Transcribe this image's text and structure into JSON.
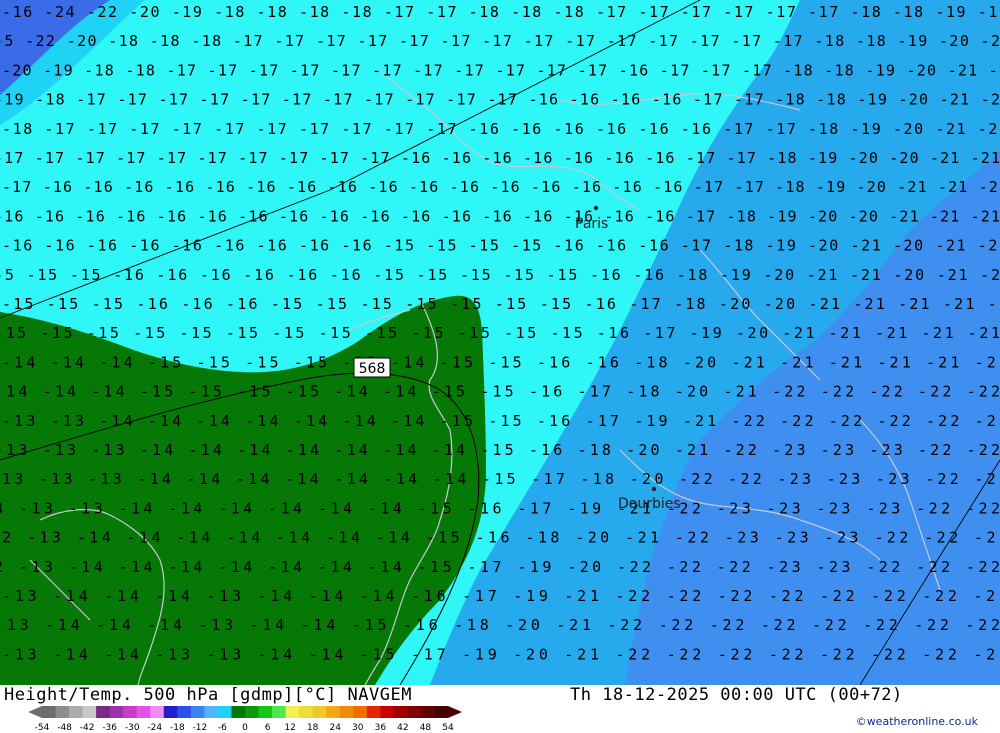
{
  "map": {
    "colors": {
      "deep_blue": "#3a6be8",
      "blue": "#3f8ff0",
      "light_blue": "#27a9ee",
      "sky": "#1fd3f7",
      "cyan": "#2ff7f7",
      "green": "#067806",
      "contour": "#000000",
      "coast": "#c8c8d8"
    },
    "height_contour_label": "568",
    "cities": [
      {
        "name": "Paris"
      },
      {
        "name": "Dourbies"
      }
    ],
    "temperature_grid": [
      "-16 -24 -22 -20 -19 -18 -18 -18 -18 -17 -17 -18 -18 -18 -17 -17 -17 -17 -17 -17 -18 -18 -19 -19",
      "-5 -22 -20 -18 -18 -18 -17 -17 -17 -17 -17 -17 -17 -17 -17 -17 -17 -17 -17 -17 -18 -18 -19 -20 -2",
      "-20 -19 -18 -18 -17 -17 -17 -17 -17 -17 -17 -17 -17 -17 -17 -16 -17 -17 -17 -18 -18 -19 -20 -21 -2",
      "-19 -18 -17 -17 -17 -17 -17 -17 -17 -17 -17 -17 -17 -16 -16 -16 -16 -17 -17 -18 -18 -19 -20 -21 -2",
      "-18 -17 -17 -17 -17 -17 -17 -17 -17 -17 -17 -16 -16 -16 -16 -16 -16 -17 -17 -18 -19 -20 -21 -21",
      "-17 -17 -17 -17 -17 -17 -17 -17 -17 -17 -16 -16 -16 -16 -16 -16 -16 -17 -17 -18 -19 -20 -20 -21 -21",
      "-17 -16 -16 -16 -16 -16 -16 -16 -16 -16 -16 -16 -16 -16 -16 -16 -16 -17 -17 -18 -19 -20 -21 -21 -21",
      "-16 -16 -16 -16 -16 -16 -16 -16 -16 -16 -16 -16 -16 -16 -16 -16 -16 -17 -18 -19 -20 -20 -21 -21 -21",
      "-16 -16 -16 -16 -16 -16 -16 -16 -16 -15 -15 -15 -15 -16 -16 -16 -17 -18 -19 -20 -21 -20 -21 -21",
      "-5 -15 -15 -16 -16 -16 -16 -16 -16 -15 -15 -15 -15 -15 -16 -16 -18 -19 -20 -21 -21 -20 -21 -2",
      "-15 -15 -15 -16 -16 -16 -15 -15 -15 -15 -15 -15 -15 -16 -17 -18 -20 -20 -21 -21 -21 -21 -2",
      "-15 -15 -15 -15 -15 -15 -15 -15 -15 -15 -15 -15 -15 -16 -17 -19 -20 -21 -21 -21 -21 -21",
      "-14 -14 -14 -15 -15 -15 -15 -15 -14 -15 -15 -16 -16 -18 -20 -21 -21 -21 -21 -21 -21",
      "-14 -14 -14 -15 -15 -15 -15 -14 -14 -15 -15 -16 -17 -18 -20 -21 -22 -22 -22 -22 -22",
      "-13 -13 -14 -14 -14 -14 -14 -14 -14 -15 -15 -16 -17 -19 -21 -22 -22 -22 -22 -22 -22",
      "-13 -13 -13 -14 -14 -14 -14 -14 -14 -14 -15 -16 -18 -20 -21 -22 -23 -23 -23 -22 -22",
      "13 -13 -13 -14 -14 -14 -14 -14 -14 -14 -15 -17 -18 -20 -22 -22 -23 -23 -23 -22 -22",
      "3 -13 -13 -14 -14 -14 -14 -14 -14 -15 -16 -17 -19 -21 -22 -23 -23 -23 -23 -22 -22",
      "2 -13 -14 -14 -14 -14 -14 -14 -14 -15 -16 -18 -20 -21 -22 -23 -23 -23 -22 -22 -22",
      "2 -13 -14 -14 -14 -14 -14 -14 -14 -15 -17 -19 -20 -22 -22 -22 -23 -23 -22 -22 -22",
      "-13 -14 -14 -14 -13 -14 -14 -14 -16 -17 -19 -21 -22 -22 -22 -22 -22 -22 -22 -22",
      "-13 -14 -14 -14 -13 -14 -14 -15 -16 -18 -20 -21 -22 -22 -22 -22 -22 -22 -22 -22",
      "-13 -14 -14 -13 -13 -14 -14 -15 -17 -19 -20 -21 -22 -22 -22 -22 -22 -22 -22 -22"
    ]
  },
  "footer": {
    "title": "Height/Temp. 500 hPa [gdmp][°C] NAVGEM",
    "datetime": "Th 18-12-2025 00:00 UTC (00+72)",
    "credit": "©weatheronline.co.uk",
    "scale_ticks": [
      "-54",
      "-48",
      "-42",
      "-36",
      "-30",
      "-24",
      "-18",
      "-12",
      "-6",
      "0",
      "6",
      "12",
      "18",
      "24",
      "30",
      "36",
      "42",
      "48",
      "54"
    ],
    "scale_colors": [
      "#6e6e6e",
      "#8c8c8c",
      "#aaaaaa",
      "#c8c8c8",
      "#7a2a8a",
      "#9a32aa",
      "#c83cc8",
      "#e650e6",
      "#f08cf0",
      "#2020c8",
      "#2a50e6",
      "#3c82f0",
      "#50b4f8",
      "#1fd3f7",
      "#067806",
      "#0a9a0a",
      "#14c814",
      "#50e650",
      "#f0f050",
      "#f0dc3c",
      "#f0c828",
      "#f0aa14",
      "#f08c0a",
      "#f06e00",
      "#e62800",
      "#c80000",
      "#a00000",
      "#820000",
      "#640000",
      "#460000"
    ]
  }
}
